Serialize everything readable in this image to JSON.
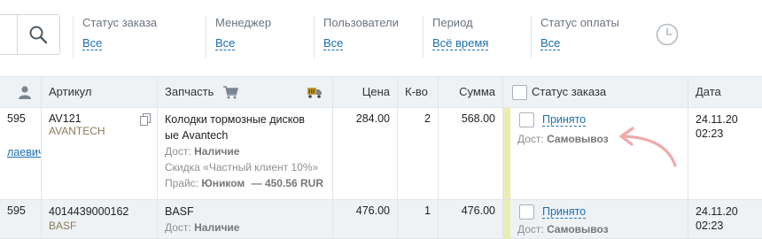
{
  "filters": {
    "order_status": {
      "label": "Статус заказа",
      "value": "Все"
    },
    "manager": {
      "label": "Менеджер",
      "value": "Все"
    },
    "users": {
      "label": "Пользователи",
      "value": "Все"
    },
    "period": {
      "label": "Период",
      "value": "Всё время"
    },
    "payment_status": {
      "label": "Статус оплаты",
      "value": "Все"
    }
  },
  "icons": {
    "search": "search-icon",
    "clock": "clock-icon",
    "user": "user-icon",
    "cart": "cart-icon",
    "truck": "truck-icon",
    "copy": "copy-icon"
  },
  "colors": {
    "link": "#1a6fb0",
    "header_bg": "#eef2f5",
    "status_strip": "#ecebb3",
    "annotation_arrow": "#f2a9a9"
  },
  "table": {
    "headers": {
      "article": "Артикул",
      "part": "Запчасть",
      "price": "Цена",
      "qty": "К-во",
      "sum": "Сумма",
      "order_status": "Статус заказа",
      "date": "Дата"
    },
    "rows": [
      {
        "id_fragment": "595",
        "client_fragment": "лаевич",
        "article": "AV121",
        "brand": "AVANTECH",
        "part_line1": "Колодки тормозные дисков",
        "part_line2": "ые Avantech",
        "delivery_label": "Дост:",
        "delivery_value": "Наличие",
        "discount": "Скидка «Частный клиент 10%»",
        "price_label": "Прайс:",
        "price_source": "Юником",
        "price_ref": "— 450.56 RUR",
        "price": "284.00",
        "qty": "2",
        "sum": "568.00",
        "status": "Принято",
        "ship_label": "Дост:",
        "ship_value": "Самовывоз",
        "date": "24.11.20",
        "time": "02:23"
      },
      {
        "id_fragment": "595",
        "article": "4014439000162",
        "brand": "BASF",
        "part_line1": "BASF",
        "delivery_label": "Дост:",
        "delivery_value": "Наличие",
        "price": "476.00",
        "qty": "1",
        "sum": "476.00",
        "status": "Принято",
        "ship_label": "Дост:",
        "ship_value": "Самовывоз",
        "date": "24.11.20",
        "time": "02:23"
      }
    ]
  }
}
